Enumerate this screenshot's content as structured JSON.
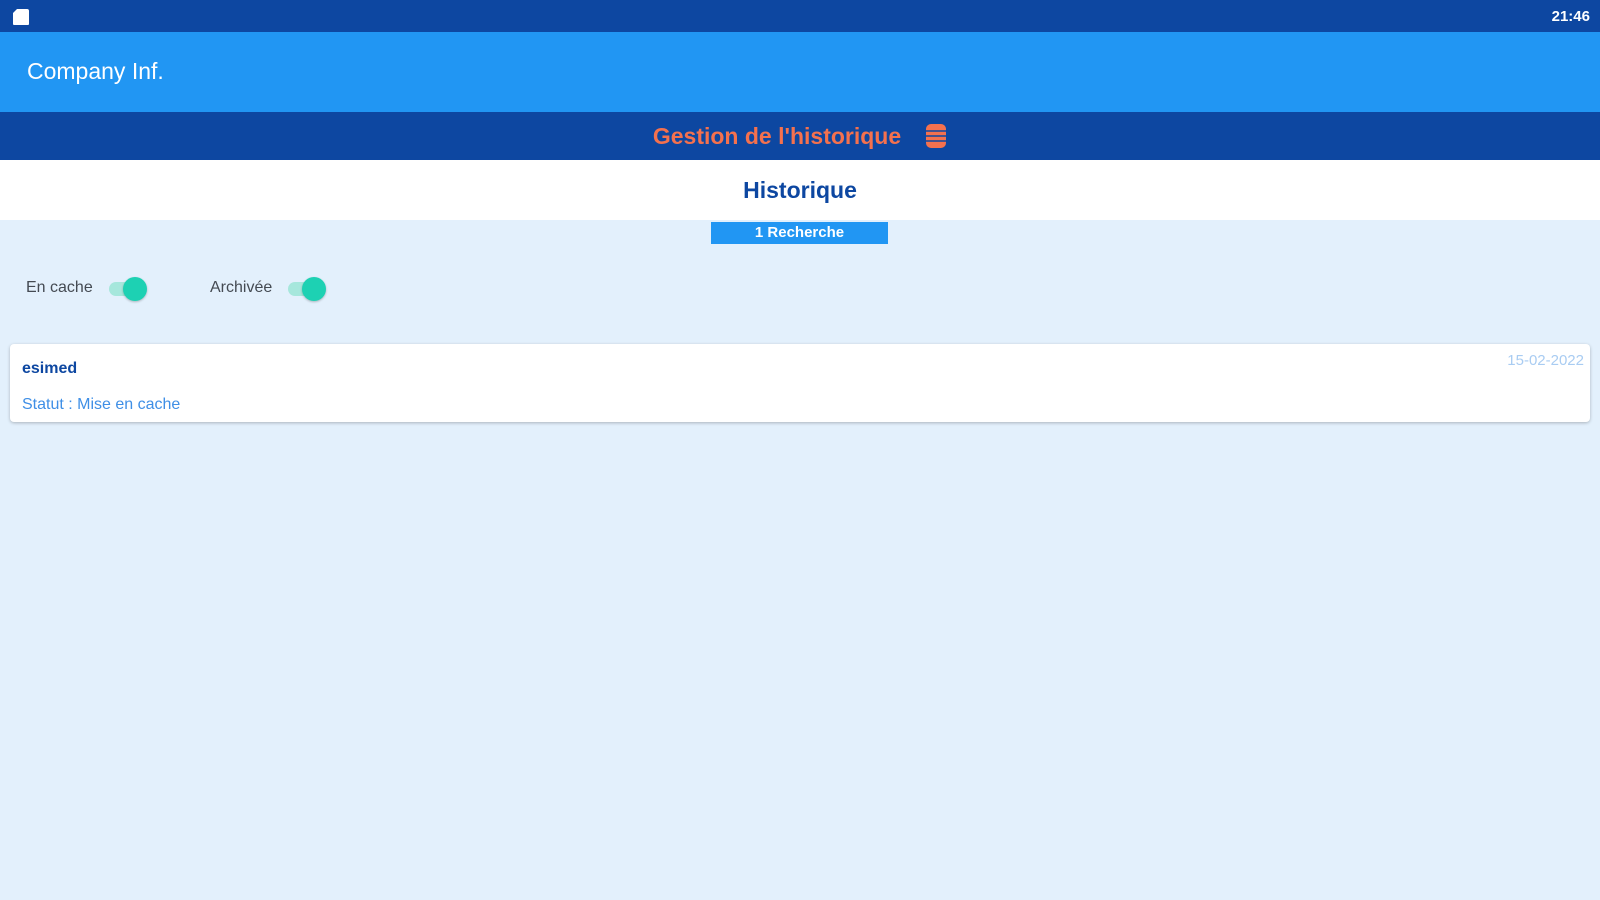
{
  "status_bar": {
    "time": "21:46",
    "left_icon": "sd-card-icon"
  },
  "app_bar": {
    "title": "Company Inf."
  },
  "sub_header": {
    "title": "Gestion de l'historique",
    "icon": "database-icon",
    "title_color": "#f4714e"
  },
  "page": {
    "title": "Historique",
    "count_badge": "1 Recherche"
  },
  "filters": [
    {
      "label": "En cache",
      "on": true
    },
    {
      "label": "Archivée",
      "on": true
    }
  ],
  "history_items": [
    {
      "name": "esimed",
      "status": "Statut : Mise en cache",
      "date": "15-02-2022"
    }
  ],
  "colors": {
    "status_bar": "#0d47a1",
    "app_bar": "#2196f3",
    "background": "#e3f0fc",
    "switch_accent": "#1dd1b3"
  }
}
